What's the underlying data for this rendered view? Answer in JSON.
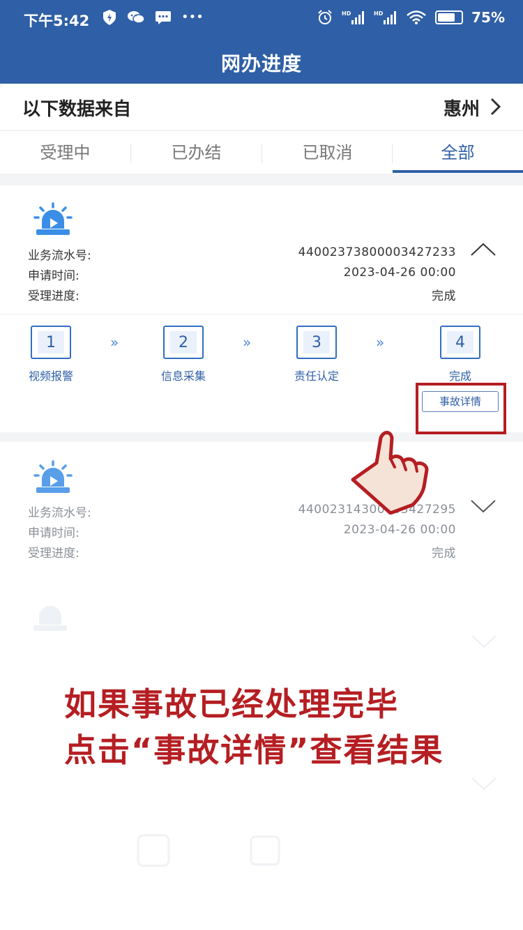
{
  "status_bar": {
    "time": "下午5:42",
    "battery": "75%",
    "battery_level": 0.75
  },
  "header": {
    "title": "网办进度"
  },
  "source": {
    "label": "以下数据来自",
    "city": "惠州"
  },
  "tabs": [
    {
      "label": "受理中"
    },
    {
      "label": "已办结"
    },
    {
      "label": "已取消"
    },
    {
      "label": "全部",
      "active": true
    }
  ],
  "records": [
    {
      "serial_label": "业务流水号:",
      "serial": "44002373800003427233",
      "time_label": "申请时间:",
      "time": "2023-04-26 00:00",
      "progress_label": "受理进度:",
      "progress": "完成",
      "expanded": true,
      "steps": [
        {
          "num": "1",
          "label": "视频报警"
        },
        {
          "num": "2",
          "label": "信息采集"
        },
        {
          "num": "3",
          "label": "责任认定"
        },
        {
          "num": "4",
          "label": "完成"
        }
      ],
      "detail_button": "事故详情"
    },
    {
      "serial_label": "业务流水号:",
      "serial": "44002314300003427295",
      "time_label": "申请时间:",
      "time": "2023-04-26 00:00",
      "progress_label": "受理进度:",
      "progress": "完成",
      "expanded": false
    }
  ],
  "instruction": {
    "line1": "如果事故已经处理完毕",
    "line2": "点击“事故详情”查看结果"
  },
  "colors": {
    "brand": "#2f5fa6",
    "accent_red": "#b51e22",
    "alarm_blue": "#3b8ee6"
  },
  "icons": {
    "alarm": "alarm-light-icon",
    "hand": "pointing-hand-icon",
    "step_arrow": "double-chevron-right-icon"
  }
}
